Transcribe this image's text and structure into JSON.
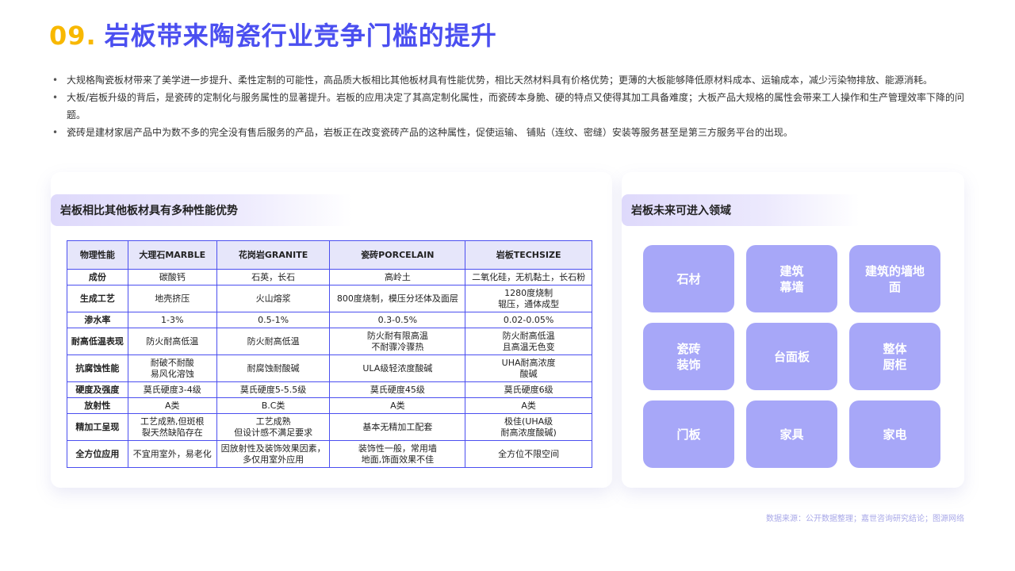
{
  "title": {
    "number": "09",
    "dot": ".",
    "text": "岩板带来陶瓷行业竞争门槛的提升"
  },
  "bullets": [
    "大规格陶瓷板材带来了美学进一步提升、柔性定制的可能性，高品质大板相比其他板材具有性能优势，相比天然材料具有价格优势；更薄的大板能够降低原材料成本、运输成本，减少污染物排放、能源消耗。",
    "大板/岩板升级的背后，是瓷砖的定制化与服务属性的显著提升。岩板的应用决定了其高定制化属性，而瓷砖本身脆、硬的特点又使得其加工具备难度；大板产品大规格的属性会带来工人操作和生产管理效率下降的问题。",
    "瓷砖是建材家居产品中为数不多的完全没有售后服务的产品，岩板正在改变瓷砖产品的这种属性，促使运输、 铺贴（连纹、密缝）安装等服务甚至是第三方服务平台的出现。"
  ],
  "left_panel": {
    "heading": "岩板相比其他板材具有多种性能优势",
    "table": {
      "headers": [
        "物理性能",
        "大理石MARBLE",
        "花岗岩GRANITE",
        "瓷砖PORCELAIN",
        "岩板TECHSIZE"
      ],
      "rows": [
        [
          "成份",
          "碳酸钙",
          "石英，长石",
          "高岭土",
          "二氧化硅，无机黏土，长石粉"
        ],
        [
          "生成工艺",
          "地壳挤压",
          "火山熔浆",
          "800度烧制，模压分坯体及面层",
          "1280度烧制\n辊压，通体成型"
        ],
        [
          "渗水率",
          "1-3%",
          "0.5-1%",
          "0.3-0.5%",
          "0.02-0.05%"
        ],
        [
          "耐高低温表现",
          "防火耐高低温",
          "防火耐高低温",
          "防火耐有限高温\n不耐骤冷骤热",
          "防火耐高低温\n且高温无色变"
        ],
        [
          "抗腐蚀性能",
          "耐破不耐酸\n易风化溶蚀",
          "耐腐蚀耐酸碱",
          "ULA级轻浓度酸碱",
          "UHA耐高浓度\n酸碱"
        ],
        [
          "硬度及强度",
          "莫氏硬度3-4级",
          "莫氏硬度5-5.5级",
          "莫氏硬度45级",
          "莫氏硬度6级"
        ],
        [
          "放射性",
          "A类",
          "B.C类",
          "A类",
          "A类"
        ],
        [
          "精加工呈现",
          "工艺成熟,但斑根\n裂天然缺陷存在",
          "工艺成熟\n但设计感不满足要求",
          "基本无精加工配套",
          "极佳(UHA级\n耐高浓度酸碱)"
        ],
        [
          "全方位应用",
          "不宜用室外，易老化",
          "因放射性及装饰效果因素，\n多仅用室外应用",
          "装饰性一般，常用墙\n地面,饰面效果不佳",
          "全方位不限空间"
        ]
      ]
    }
  },
  "right_panel": {
    "heading": "岩板未来可进入领域",
    "tiles": [
      "石材",
      "建筑\n幕墙",
      "建筑的墙地\n面",
      "瓷砖\n装饰",
      "台面板",
      "整体\n厨柜",
      "门板",
      "家具",
      "家电"
    ]
  },
  "source": "数据来源：公开数据整理；嘉世咨询研究结论；图源网络",
  "colors": {
    "accent": "#4b4ff0",
    "number": "#f8b800",
    "tile": "#a7a7f8",
    "header_bg": "#e6e6fa"
  }
}
